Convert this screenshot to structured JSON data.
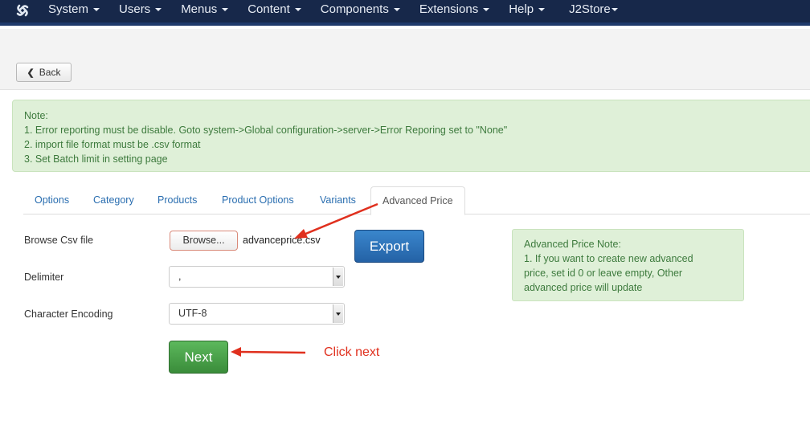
{
  "navbar": {
    "logo_icon": "joomla-logo-icon",
    "items": [
      {
        "label": "System",
        "has_caret": true
      },
      {
        "label": "Users",
        "has_caret": true
      },
      {
        "label": "Menus",
        "has_caret": true
      },
      {
        "label": "Content",
        "has_caret": true
      },
      {
        "label": "Components",
        "has_caret": true
      },
      {
        "label": "Extensions",
        "has_caret": true
      },
      {
        "label": "Help",
        "has_caret": true
      },
      {
        "label": "J2Store",
        "has_caret": true
      }
    ]
  },
  "toolbar": {
    "back_label": "Back",
    "back_icon": "chevron-left-icon"
  },
  "alert": {
    "lines": [
      "Note:",
      "1. Error reporting must be disable. Goto system->Global configuration->server->Error Reporing set to \"None\"",
      "2. import file format must be .csv format",
      "3. Set Batch limit in setting page"
    ]
  },
  "tabs": [
    {
      "label": "Options",
      "active": false
    },
    {
      "label": "Category",
      "active": false
    },
    {
      "label": "Products",
      "active": false
    },
    {
      "label": "Product Options",
      "active": false
    },
    {
      "label": "Variants",
      "active": false
    },
    {
      "label": "Advanced Price",
      "active": true
    }
  ],
  "form": {
    "browse_label": "Browse Csv file",
    "browse_button": "Browse...",
    "file_name": "advanceprice.csv",
    "export_button": "Export",
    "delimiter_label": "Delimiter",
    "delimiter_value": ",",
    "encoding_label": "Character Encoding",
    "encoding_value": "UTF-8",
    "next_button": "Next"
  },
  "side_note": {
    "lines": [
      "Advanced Price Note:",
      "1. If you want to create new advanced",
      "price, set id 0 or leave empty, Other",
      "advanced price will update"
    ]
  },
  "annotations": {
    "click_next": "Click next",
    "arrow_color": "#e0301e"
  },
  "colors": {
    "navbar": "#17284a",
    "alert_bg": "#dff0d8",
    "alert_text": "#3d7a3d",
    "export_button": "#2462a6",
    "next_button": "#3a8c3a",
    "link": "#2a6eb0"
  }
}
